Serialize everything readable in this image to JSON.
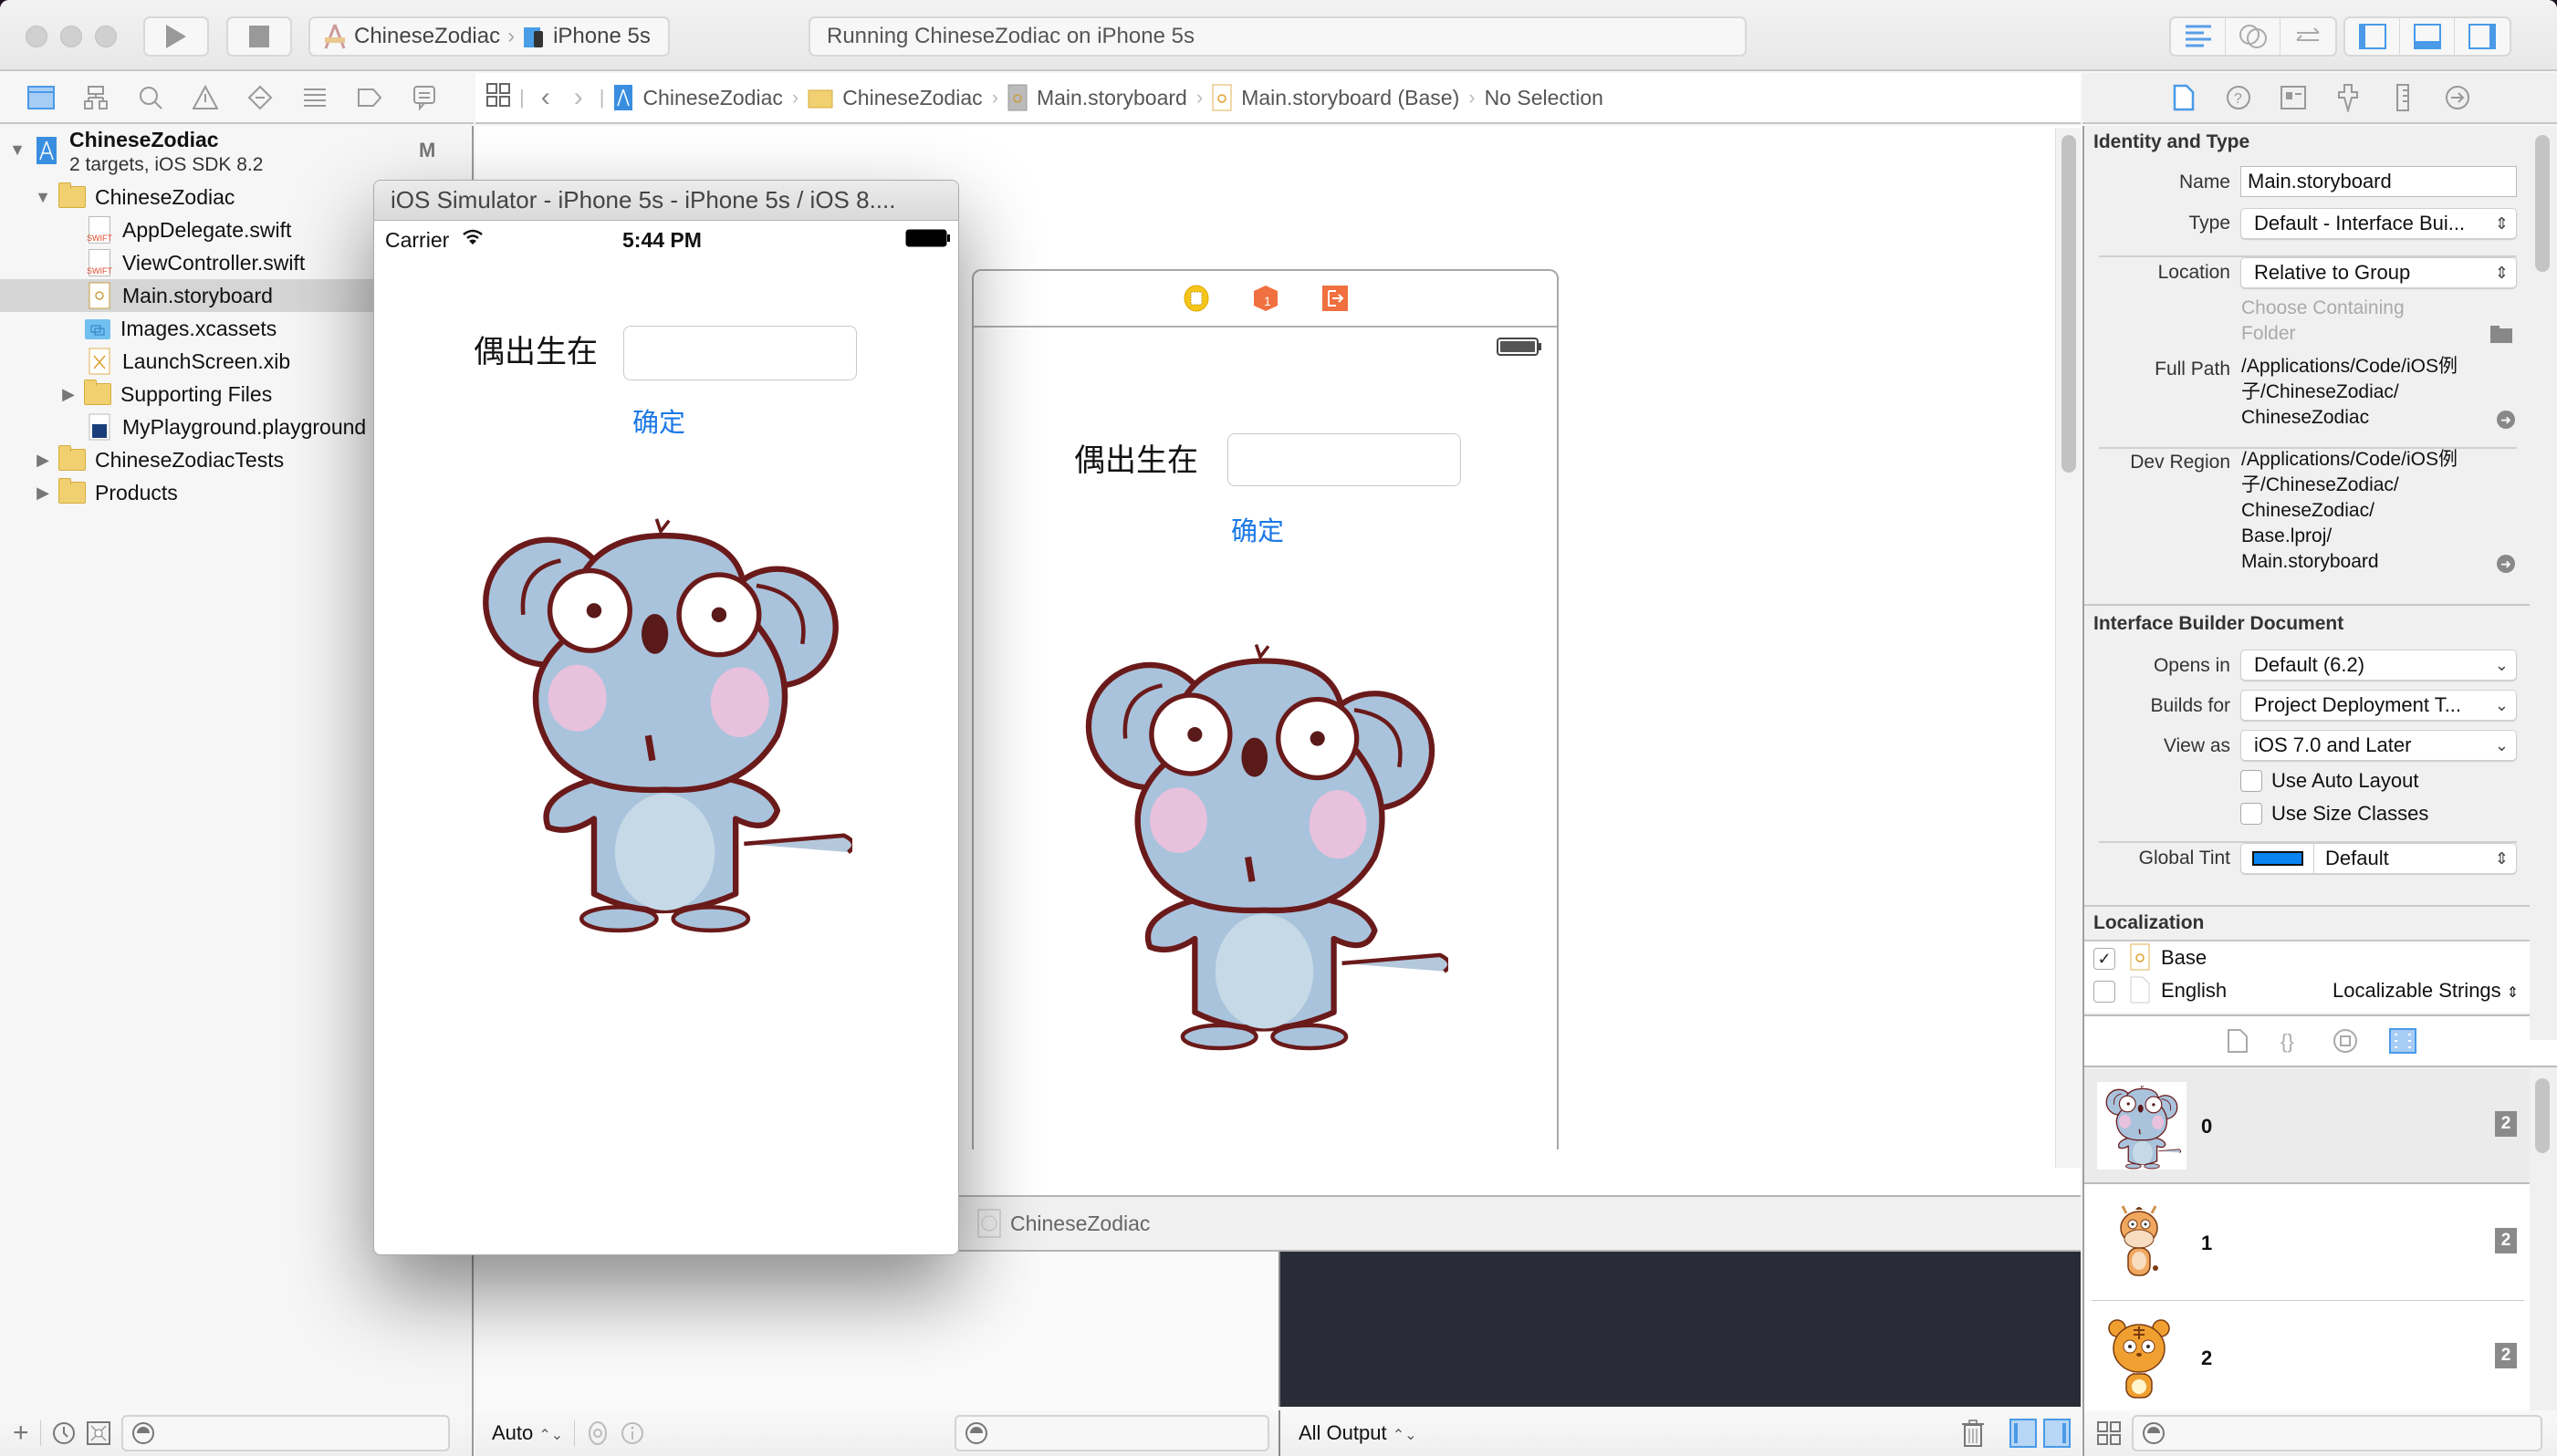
{
  "toolbar": {
    "scheme": "ChineseZodiac",
    "destination": "iPhone 5s",
    "activity": "Running ChineseZodiac on iPhone 5s"
  },
  "jumpbar": {
    "items": [
      "ChineseZodiac",
      "ChineseZodiac",
      "Main.storyboard",
      "Main.storyboard (Base)",
      "No Selection"
    ]
  },
  "navigator": {
    "project": {
      "name": "ChineseZodiac",
      "subtitle": "2 targets, iOS SDK 8.2",
      "badge": "M"
    },
    "items": [
      {
        "label": "ChineseZodiac",
        "type": "folder",
        "expanded": true
      },
      {
        "label": "AppDelegate.swift",
        "type": "swift"
      },
      {
        "label": "ViewController.swift",
        "type": "swift"
      },
      {
        "label": "Main.storyboard",
        "type": "storyboard",
        "selected": true
      },
      {
        "label": "Images.xcassets",
        "type": "xcassets"
      },
      {
        "label": "LaunchScreen.xib",
        "type": "xib"
      },
      {
        "label": "Supporting Files",
        "type": "folder",
        "expanded": false
      },
      {
        "label": "MyPlayground.playground",
        "type": "playground"
      },
      {
        "label": "ChineseZodiacTests",
        "type": "folder",
        "expanded": false
      },
      {
        "label": "Products",
        "type": "folder",
        "expanded": false
      }
    ]
  },
  "simulator": {
    "title": "iOS Simulator - iPhone 5s - iPhone 5s / iOS 8....",
    "carrier": "Carrier",
    "time": "5:44 PM",
    "label": "偶出生在",
    "button": "确定",
    "textfield_value": ""
  },
  "storyboard": {
    "label": "偶出生在",
    "button": "确定",
    "scene_name": "ChineseZodiac"
  },
  "debug": {
    "auto_label": "Auto",
    "output_label": "All Output"
  },
  "inspector": {
    "identity": {
      "title": "Identity and Type",
      "name_label": "Name",
      "name_value": "Main.storyboard",
      "type_label": "Type",
      "type_value": "Default - Interface Bui...",
      "location_label": "Location",
      "location_value": "Relative to Group",
      "choose_folder": "Choose Containing Folder",
      "fullpath_label": "Full Path",
      "fullpath_lines": [
        "/Applications/Code/iOS例",
        "子/ChineseZodiac/",
        "ChineseZodiac"
      ],
      "devregion_label": "Dev Region",
      "devregion_lines": [
        "/Applications/Code/iOS例",
        "子/ChineseZodiac/",
        "ChineseZodiac/",
        "Base.lproj/",
        "Main.storyboard"
      ]
    },
    "ibdoc": {
      "title": "Interface Builder Document",
      "opens_label": "Opens in",
      "opens_value": "Default (6.2)",
      "builds_label": "Builds for",
      "builds_value": "Project Deployment T...",
      "viewas_label": "View as",
      "viewas_value": "iOS 7.0 and Later",
      "autolayout_label": "Use Auto Layout",
      "autolayout_checked": false,
      "sizeclasses_label": "Use Size Classes",
      "sizeclasses_checked": false,
      "tint_label": "Global Tint",
      "tint_value": "Default",
      "tint_color": "#0a84f0"
    },
    "localization": {
      "title": "Localization",
      "rows": [
        {
          "label": "Base",
          "checked": true,
          "type": ""
        },
        {
          "label": "English",
          "checked": false,
          "type": "Localizable Strings"
        }
      ]
    },
    "library": {
      "items": [
        {
          "label": "0",
          "badge": "2",
          "animal": "rat"
        },
        {
          "label": "1",
          "badge": "2",
          "animal": "ox"
        },
        {
          "label": "2",
          "badge": "2",
          "animal": "tiger"
        }
      ]
    }
  },
  "colors": {
    "accent": "#1a78e5",
    "console_bg": "#292b36"
  }
}
